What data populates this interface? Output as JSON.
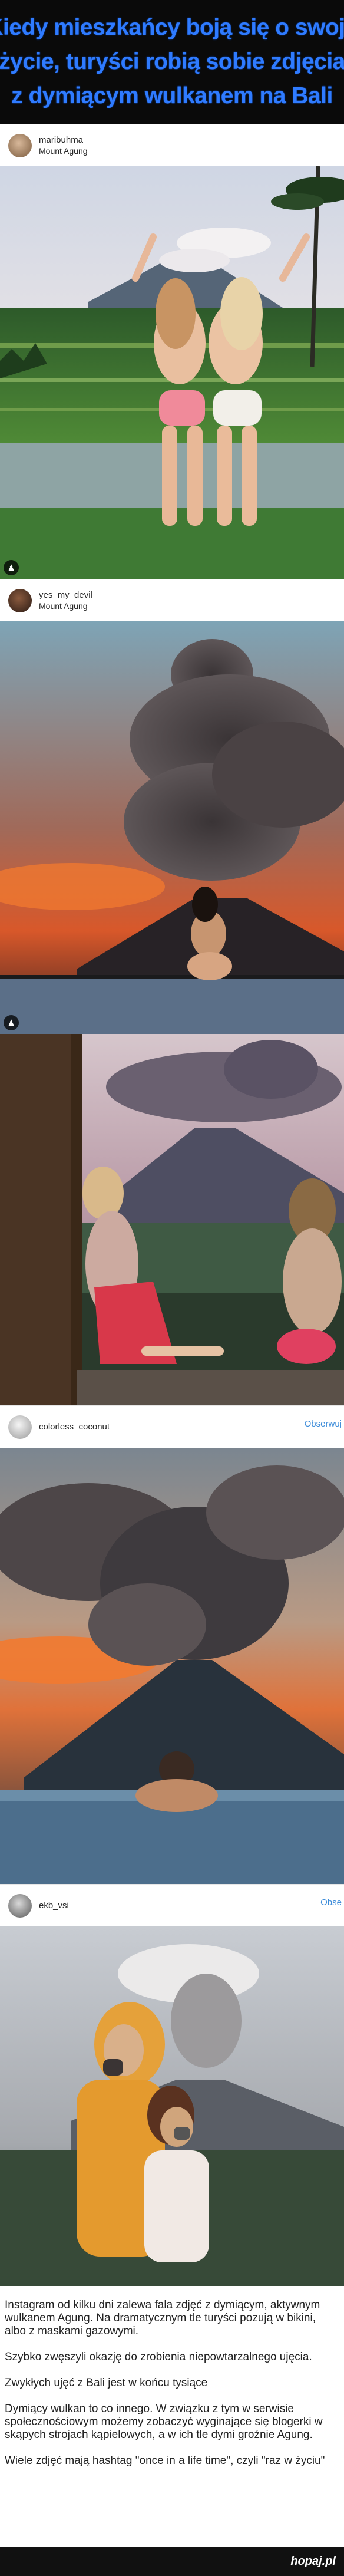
{
  "headline": {
    "line1": "Kiedy mieszkańcy boją się o swoje",
    "line2": "życie, turyści robią sobie zdjęcia",
    "line3": "z dymiącym wulkanem na Bali"
  },
  "posts": [
    {
      "username": "maribuhma",
      "location": "Mount Agung"
    },
    {
      "username": "yes_my_devil",
      "location": "Mount Agung"
    },
    {
      "username": "colorless_coconut",
      "location": "",
      "follow": "Obserwuj"
    },
    {
      "username": "ekb_vsi",
      "location": "",
      "follow": "Obse"
    }
  ],
  "description": {
    "p1": "Instagram od kilku dni zalewa fala zdjęć z dymiącym, aktywnym wulkanem Agung. Na dramatycznym tle turyści pozują w bikini, albo z maskami gazowymi.",
    "p2": "Szybko zwęszyli okazję do zrobienia niepowtarzalnego ujęcia.",
    "p3": "Zwykłych ujęć z Bali jest w końcu tysiące",
    "p4": "Dymiący wulkan to co innego. W związku z tym w serwisie społecznościowym możemy zobaczyć wyginające się blogerki w skąpych strojach kąpielowych, a w ich tle dymi groźnie Agung.",
    "p5": "Wiele zdjęć mają hashtag \"once in a life time\", czyli \"raz w życiu\""
  },
  "footer": {
    "site": "hopaj.pl"
  },
  "colors": {
    "headline": "#2f7bff",
    "follow": "#3b8bd9",
    "background": "#000000"
  }
}
